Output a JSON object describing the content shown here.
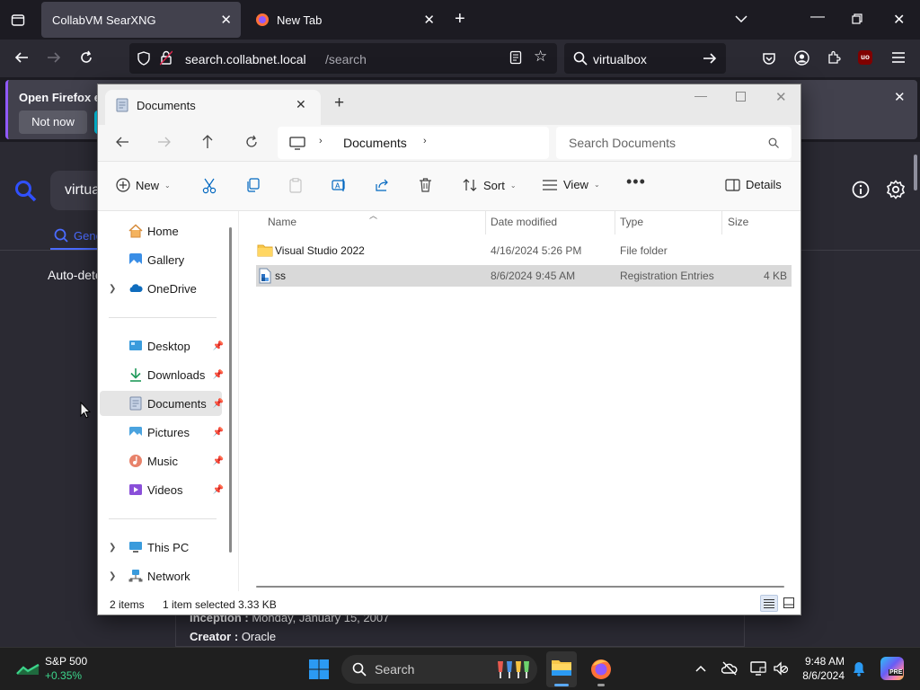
{
  "browser": {
    "tabs": [
      {
        "title": "CollabVM SearXNG",
        "active": true
      },
      {
        "title": "New Tab",
        "active": false
      }
    ],
    "url": {
      "host": "search.collabnet.local",
      "path": "/search"
    },
    "search_value": "virtualbox",
    "notification": {
      "text": "Open Firefox ev",
      "not_now": "Not now"
    },
    "page": {
      "query_value": "virtua",
      "tab_general": "Gene",
      "auto_detect": "Auto-dete",
      "inception_label": "Inception :",
      "inception_value": "Monday, January 15, 2007",
      "creator_label": "Creator :",
      "creator_value": "Oracle"
    }
  },
  "explorer": {
    "tab_title": "Documents",
    "breadcrumb": "Documents",
    "search_placeholder": "Search Documents",
    "commands": {
      "new": "New",
      "sort": "Sort",
      "view": "View",
      "details": "Details"
    },
    "sidebar": {
      "home": "Home",
      "gallery": "Gallery",
      "onedrive": "OneDrive",
      "desktop": "Desktop",
      "downloads": "Downloads",
      "documents": "Documents",
      "pictures": "Pictures",
      "music": "Music",
      "videos": "Videos",
      "thispc": "This PC",
      "network": "Network"
    },
    "columns": {
      "name": "Name",
      "date": "Date modified",
      "type": "Type",
      "size": "Size"
    },
    "files": [
      {
        "name": "Visual Studio 2022",
        "date": "4/16/2024 5:26 PM",
        "type": "File folder",
        "size": ""
      },
      {
        "name": "ss",
        "date": "8/6/2024 9:45 AM",
        "type": "Registration Entries",
        "size": "4 KB"
      }
    ],
    "status": {
      "items": "2 items",
      "selected": "1 item selected  3.33 KB"
    }
  },
  "taskbar": {
    "stock_name": "S&P 500",
    "stock_change": "+0.35%",
    "search_label": "Search",
    "time": "9:48 AM",
    "date": "8/6/2024"
  },
  "colors": {
    "accent": "#0078d4",
    "firefox_purple": "#9059ff",
    "stock_green": "#3dd68c"
  }
}
